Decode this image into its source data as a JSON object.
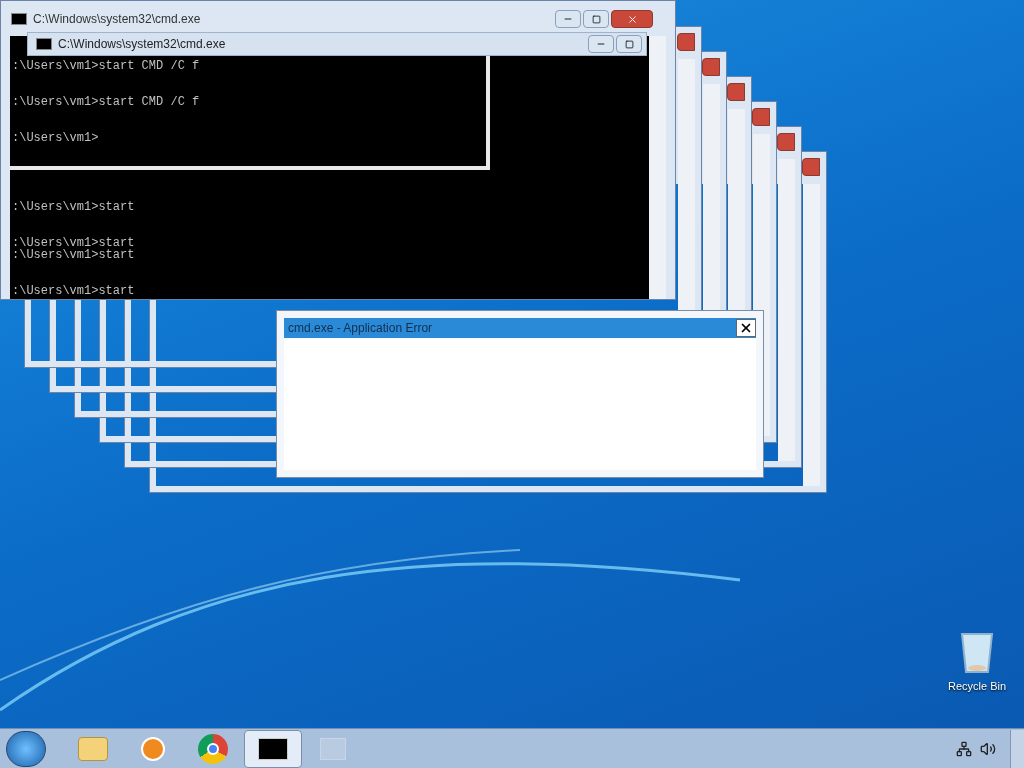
{
  "background_windows": [
    {
      "kind": "frame"
    },
    {
      "kind": "frame"
    },
    {
      "kind": "frame"
    },
    {
      "kind": "frame"
    },
    {
      "kind": "frame"
    },
    {
      "kind": "frame"
    }
  ],
  "console_back": {
    "title": "C:\\Windows\\system32\\cmd.exe",
    "blocks": [
      [
        ":\\Users\\vm1>start"
      ],
      [
        ":\\Users\\vm1>start",
        ":\\Users\\vm1>start"
      ],
      [
        ":\\Users\\vm1>start"
      ]
    ]
  },
  "console_front": {
    "title": "C:\\Windows\\system32\\cmd.exe",
    "blocks": [
      [
        ":\\Users\\vm1>start CMD /C f"
      ],
      [
        ":\\Users\\vm1>start CMD /C f"
      ],
      [
        ":\\Users\\vm1>"
      ]
    ]
  },
  "error_dialog": {
    "title": "cmd.exe - Application Error"
  },
  "desktop_icons": [
    {
      "label": "Recycle Bin"
    }
  ],
  "taskbar": {
    "items": [
      {
        "kind": "folder",
        "selected": false
      },
      {
        "kind": "media",
        "selected": false
      },
      {
        "kind": "browser",
        "selected": false
      },
      {
        "kind": "console",
        "selected": true
      },
      {
        "kind": "blank",
        "selected": false
      }
    ]
  }
}
